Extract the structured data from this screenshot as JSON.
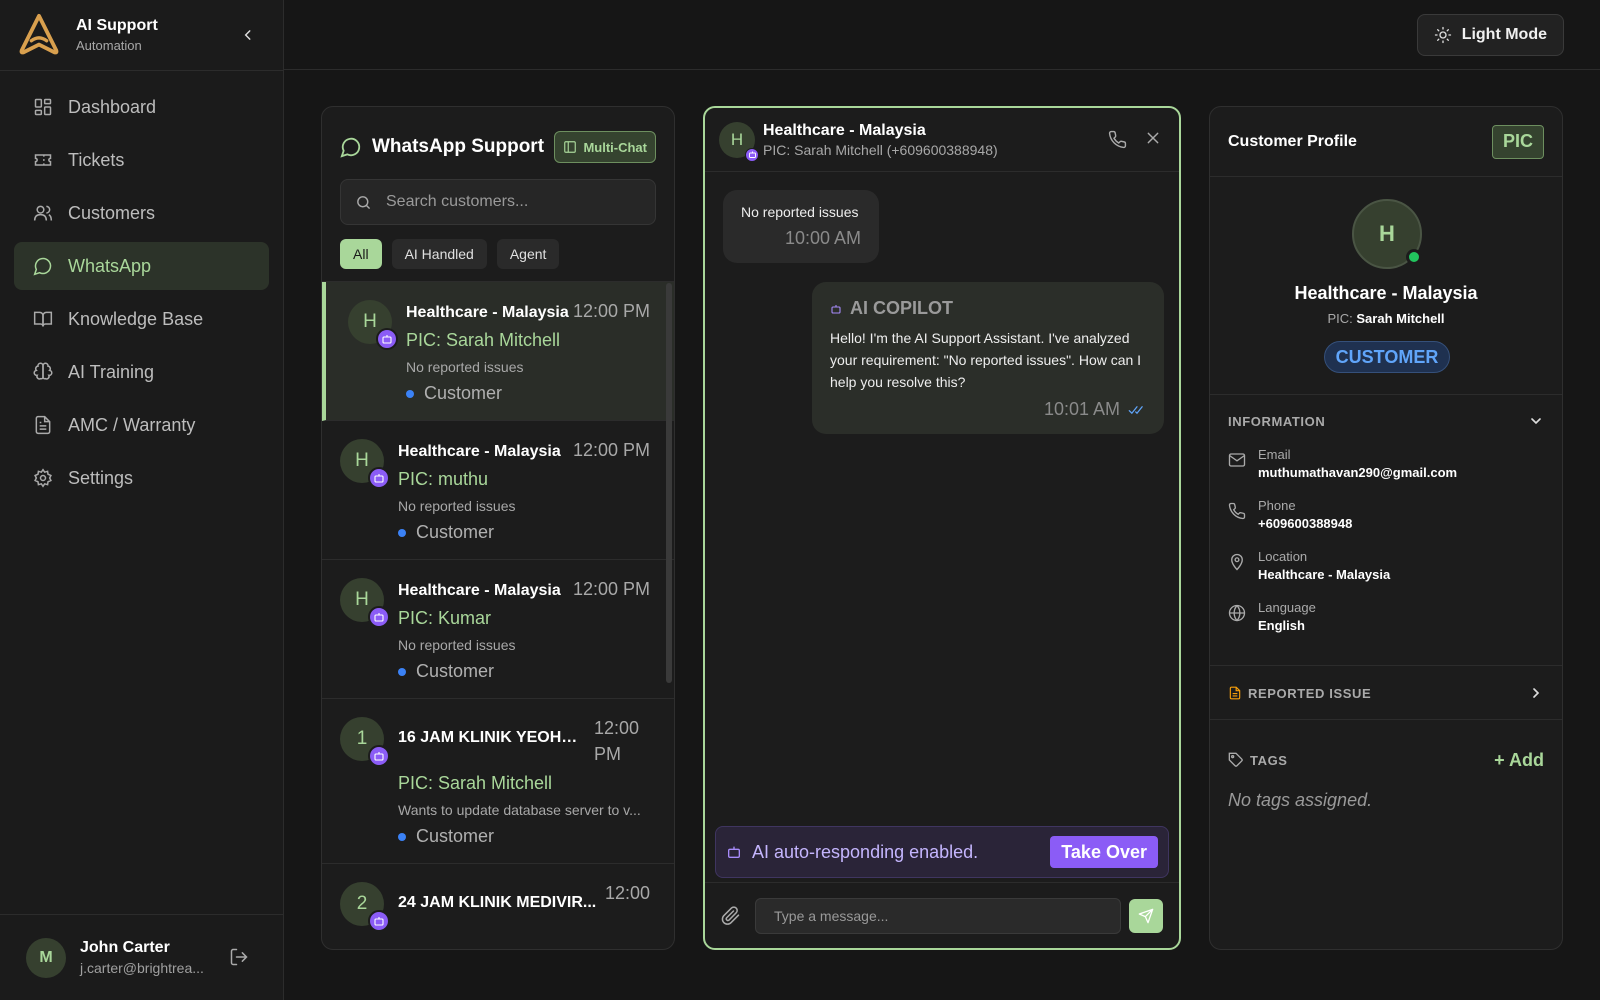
{
  "app": {
    "title": "AI Support",
    "subtitle": "Automation"
  },
  "sidebar": {
    "items": [
      {
        "label": "Dashboard",
        "icon": "dashboard-icon"
      },
      {
        "label": "Tickets",
        "icon": "ticket-icon"
      },
      {
        "label": "Customers",
        "icon": "users-icon"
      },
      {
        "label": "WhatsApp",
        "icon": "chat-bubble-icon",
        "active": true
      },
      {
        "label": "Knowledge Base",
        "icon": "book-icon"
      },
      {
        "label": "AI Training",
        "icon": "brain-icon"
      },
      {
        "label": "AMC / Warranty",
        "icon": "document-icon"
      },
      {
        "label": "Settings",
        "icon": "gear-icon"
      }
    ]
  },
  "user": {
    "initial": "M",
    "name": "John Carter",
    "email": "j.carter@brightrea..."
  },
  "topbar": {
    "mode_label": "Light Mode"
  },
  "list": {
    "title": "WhatsApp Support",
    "multi_chat_label": "Multi-Chat",
    "search_placeholder": "Search customers...",
    "filters": [
      "All",
      "AI Handled",
      "Agent"
    ],
    "conversations": [
      {
        "initial": "H",
        "name": "Healthcare - Malaysia",
        "time": "12:00 PM",
        "pic": "PIC: Sarah Mitchell",
        "message": "No reported issues",
        "tag": "Customer"
      },
      {
        "initial": "H",
        "name": "Healthcare - Malaysia",
        "time": "12:00 PM",
        "pic": "PIC: muthu",
        "message": "No reported issues",
        "tag": "Customer"
      },
      {
        "initial": "H",
        "name": "Healthcare - Malaysia",
        "time": "12:00 PM",
        "pic": "PIC: Kumar",
        "message": "No reported issues",
        "tag": "Customer"
      },
      {
        "initial": "1",
        "name": "16 JAM KLINIK YEOH ...",
        "time": "12:00 PM",
        "pic": "PIC: Sarah Mitchell",
        "message": "Wants to update database server to v...",
        "tag": "Customer"
      },
      {
        "initial": "2",
        "name": "24 JAM KLINIK MEDIVIR...",
        "time": "12:00",
        "pic": "",
        "message": "",
        "tag": ""
      }
    ]
  },
  "chat": {
    "initial": "H",
    "title": "Healthcare - Malaysia",
    "subtitle": "PIC: Sarah Mitchell (+609600388948)",
    "incoming": {
      "text": "No reported issues",
      "time": "10:00 AM"
    },
    "outgoing": {
      "label": "AI COPILOT",
      "text": "Hello! I'm the AI Support Assistant. I've analyzed your requirement: \"No reported issues\". How can I help you resolve this?",
      "time": "10:01 AM"
    },
    "auto_text": "AI auto-responding enabled.",
    "take_over_label": "Take Over",
    "input_placeholder": "Type a message..."
  },
  "profile": {
    "title": "Customer Profile",
    "pic_badge": "PIC",
    "initial": "H",
    "name": "Healthcare - Malaysia",
    "pic_label": "PIC:",
    "pic_name": "Sarah Mitchell",
    "type_badge": "CUSTOMER",
    "info_title": "INFORMATION",
    "info": [
      {
        "label": "Email",
        "value": "muthumathavan290@gmail.com",
        "icon": "mail-icon"
      },
      {
        "label": "Phone",
        "value": "+609600388948",
        "icon": "phone-icon"
      },
      {
        "label": "Location",
        "value": "Healthcare - Malaysia",
        "icon": "location-pin-icon"
      },
      {
        "label": "Language",
        "value": "English",
        "icon": "globe-icon"
      }
    ],
    "reported_title": "REPORTED ISSUE",
    "tags_title": "TAGS",
    "add_label": "+ Add",
    "no_tags": "No tags assigned."
  },
  "colors": {
    "accent": "#a9d79a",
    "bot": "#8b5cf6",
    "customer": "#3b82f6",
    "online": "#22c55e",
    "warning": "#f59e0b"
  }
}
